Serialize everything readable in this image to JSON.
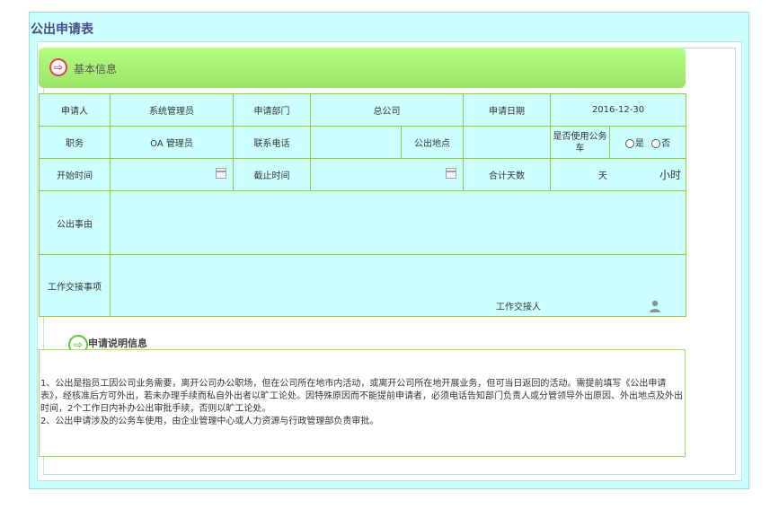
{
  "page_title": "公出申请表",
  "basic_info": {
    "title": "基本信息"
  },
  "form": {
    "applicant_label": "申请人",
    "applicant_value": "系统管理员",
    "dept_label": "申请部门",
    "dept_value": "总公司",
    "date_label": "申请日期",
    "date_value": "2016-12-30",
    "position_label": "职务",
    "position_value": "OA 管理员",
    "phone_label": "联系电话",
    "phone_value": "",
    "location_label": "公出地点",
    "location_value": "",
    "car_label": "是否使用公务车",
    "car_yes": "是",
    "car_no": "否",
    "start_label": "开始时间",
    "end_label": "截止时间",
    "total_label": "合计天数",
    "day_unit": "天",
    "hour_unit": "小时",
    "reason_label": "公出事由",
    "handover_label": "工作交接事项",
    "handover_person_label": "工作交接人"
  },
  "notes": {
    "title": "申请说明信息",
    "line1": "1、公出是指员工因公司业务需要，离开公司办公职场，但在公司所在地市内活动，或离开公司所在地开展业务，但可当日返回的活动。需提前填写《公出申请表》，经核准后方可外出，若未办理手续而私自外出者以旷工论处。因特殊原因而不能提前申请者，必须电话告知部门负责人或分管领导外出原因、外出地点及外出时间，2个工作日内补办公出审批手续，否则以旷工论处。",
    "line2": "2、公出申请涉及的公务车使用，由企业管理中心或人力资源与行政管理部负责审批。"
  }
}
